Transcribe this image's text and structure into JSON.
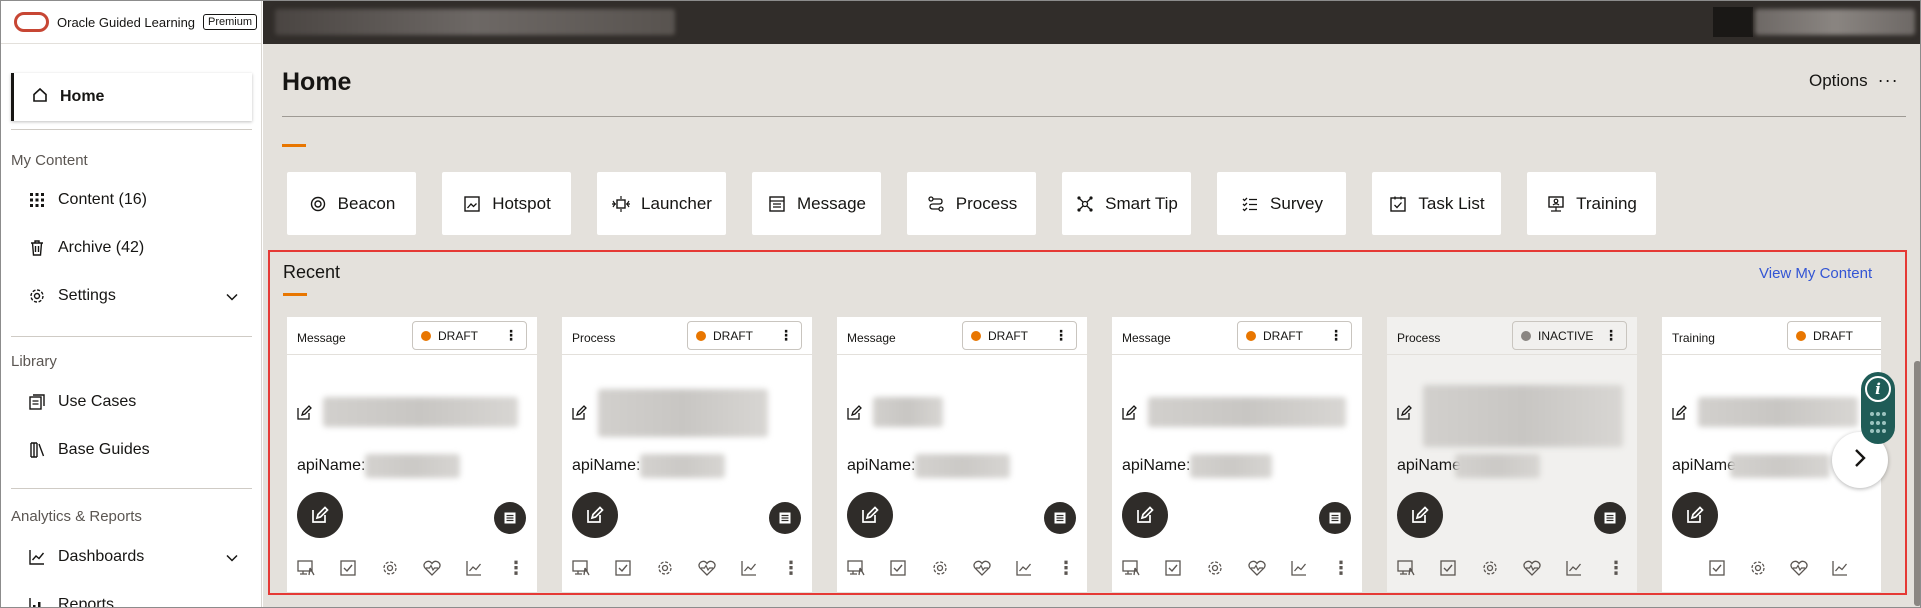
{
  "brand": {
    "name": "Oracle Guided Learning",
    "badge": "Premium",
    "color": "#c74634"
  },
  "sidebar": {
    "home": "Home",
    "sections": {
      "my_content": "My Content",
      "library": "Library",
      "analytics": "Analytics & Reports"
    },
    "items": [
      {
        "label": "Content (16)",
        "icon": "grid-icon"
      },
      {
        "label": "Archive (42)",
        "icon": "archive-icon"
      },
      {
        "label": "Settings",
        "icon": "gear-icon"
      },
      {
        "label": "Use Cases",
        "icon": "use-cases-icon"
      },
      {
        "label": "Base Guides",
        "icon": "book-icon"
      },
      {
        "label": "Dashboards",
        "icon": "dashboard-icon"
      },
      {
        "label": "Reports",
        "icon": "reports-icon"
      }
    ]
  },
  "main": {
    "title": "Home",
    "options_label": "Options",
    "options_more": "···",
    "accent": "#e87600",
    "content_types": [
      "Beacon",
      "Hotspot",
      "Launcher",
      "Message",
      "Process",
      "Smart Tip",
      "Survey",
      "Task List",
      "Training"
    ]
  },
  "recent": {
    "title": "Recent",
    "view_all": "View My Content",
    "api_label": "apiName:",
    "api_label_short": "apiName",
    "cards": [
      {
        "type": "Message",
        "status": "DRAFT",
        "status_color": "#e87600"
      },
      {
        "type": "Process",
        "status": "DRAFT",
        "status_color": "#e87600"
      },
      {
        "type": "Message",
        "status": "DRAFT",
        "status_color": "#e87600"
      },
      {
        "type": "Message",
        "status": "DRAFT",
        "status_color": "#e87600"
      },
      {
        "type": "Process",
        "status": "INACTIVE",
        "status_color": "#8a8682"
      },
      {
        "type": "Training",
        "status": "DRAFT",
        "status_color": "#e87600"
      }
    ]
  }
}
